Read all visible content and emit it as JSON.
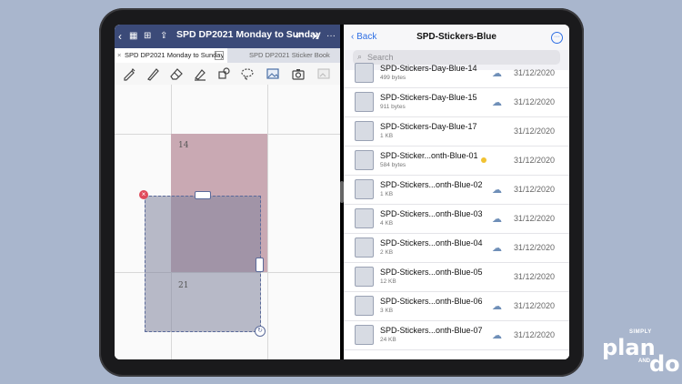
{
  "left_pane": {
    "title": "SPD DP2021 Monday to Sunday",
    "tabs": [
      {
        "label": "SPD DP2021 Monday to Sunday",
        "close": "×"
      },
      {
        "label": "SPD DP2021 Sticker Book"
      }
    ],
    "toolbar_icons": [
      "pen-icon",
      "pen-icon",
      "eraser-icon",
      "highlighter-icon",
      "shapes-icon",
      "lasso-icon",
      "image-icon",
      "camera-icon",
      "sticker-icon"
    ],
    "canvas": {
      "day_numbers": [
        "14",
        "21"
      ],
      "pink_color": "#c9a9b3",
      "selection_close": "×"
    }
  },
  "right_pane": {
    "back_label": "Back",
    "title": "SPD-Stickers-Blue",
    "more_label": "···",
    "search_placeholder": "Search",
    "files": [
      {
        "name": "SPD-Stickers-Day-Blue-14",
        "size": "499 bytes",
        "date": "31/12/2020",
        "cloud": true
      },
      {
        "name": "SPD-Stickers-Day-Blue-15",
        "size": "911 bytes",
        "date": "31/12/2020",
        "cloud": true
      },
      {
        "name": "SPD-Stickers-Day-Blue-17",
        "size": "1 KB",
        "date": "31/12/2020",
        "cloud": false
      },
      {
        "name": "SPD-Sticker...onth-Blue-01",
        "size": "584 bytes",
        "date": "31/12/2020",
        "cloud": false,
        "tag": "#f1c232"
      },
      {
        "name": "SPD-Stickers...onth-Blue-02",
        "size": "1 KB",
        "date": "31/12/2020",
        "cloud": true
      },
      {
        "name": "SPD-Stickers...onth-Blue-03",
        "size": "4 KB",
        "date": "31/12/2020",
        "cloud": true
      },
      {
        "name": "SPD-Stickers...onth-Blue-04",
        "size": "2 KB",
        "date": "31/12/2020",
        "cloud": true
      },
      {
        "name": "SPD-Stickers...onth-Blue-05",
        "size": "12 KB",
        "date": "31/12/2020",
        "cloud": false
      },
      {
        "name": "SPD-Stickers...onth-Blue-06",
        "size": "3 KB",
        "date": "31/12/2020",
        "cloud": true
      },
      {
        "name": "SPD-Stickers...onth-Blue-07",
        "size": "24 KB",
        "date": "31/12/2020",
        "cloud": true
      }
    ]
  },
  "logo": {
    "simply": "SIMPLY",
    "plan": "plan",
    "and": "AND",
    "do": "do"
  },
  "colors": {
    "accent": "#2f6fe4",
    "titlebar": "#3b4a78",
    "background": "#a9b6cd"
  }
}
